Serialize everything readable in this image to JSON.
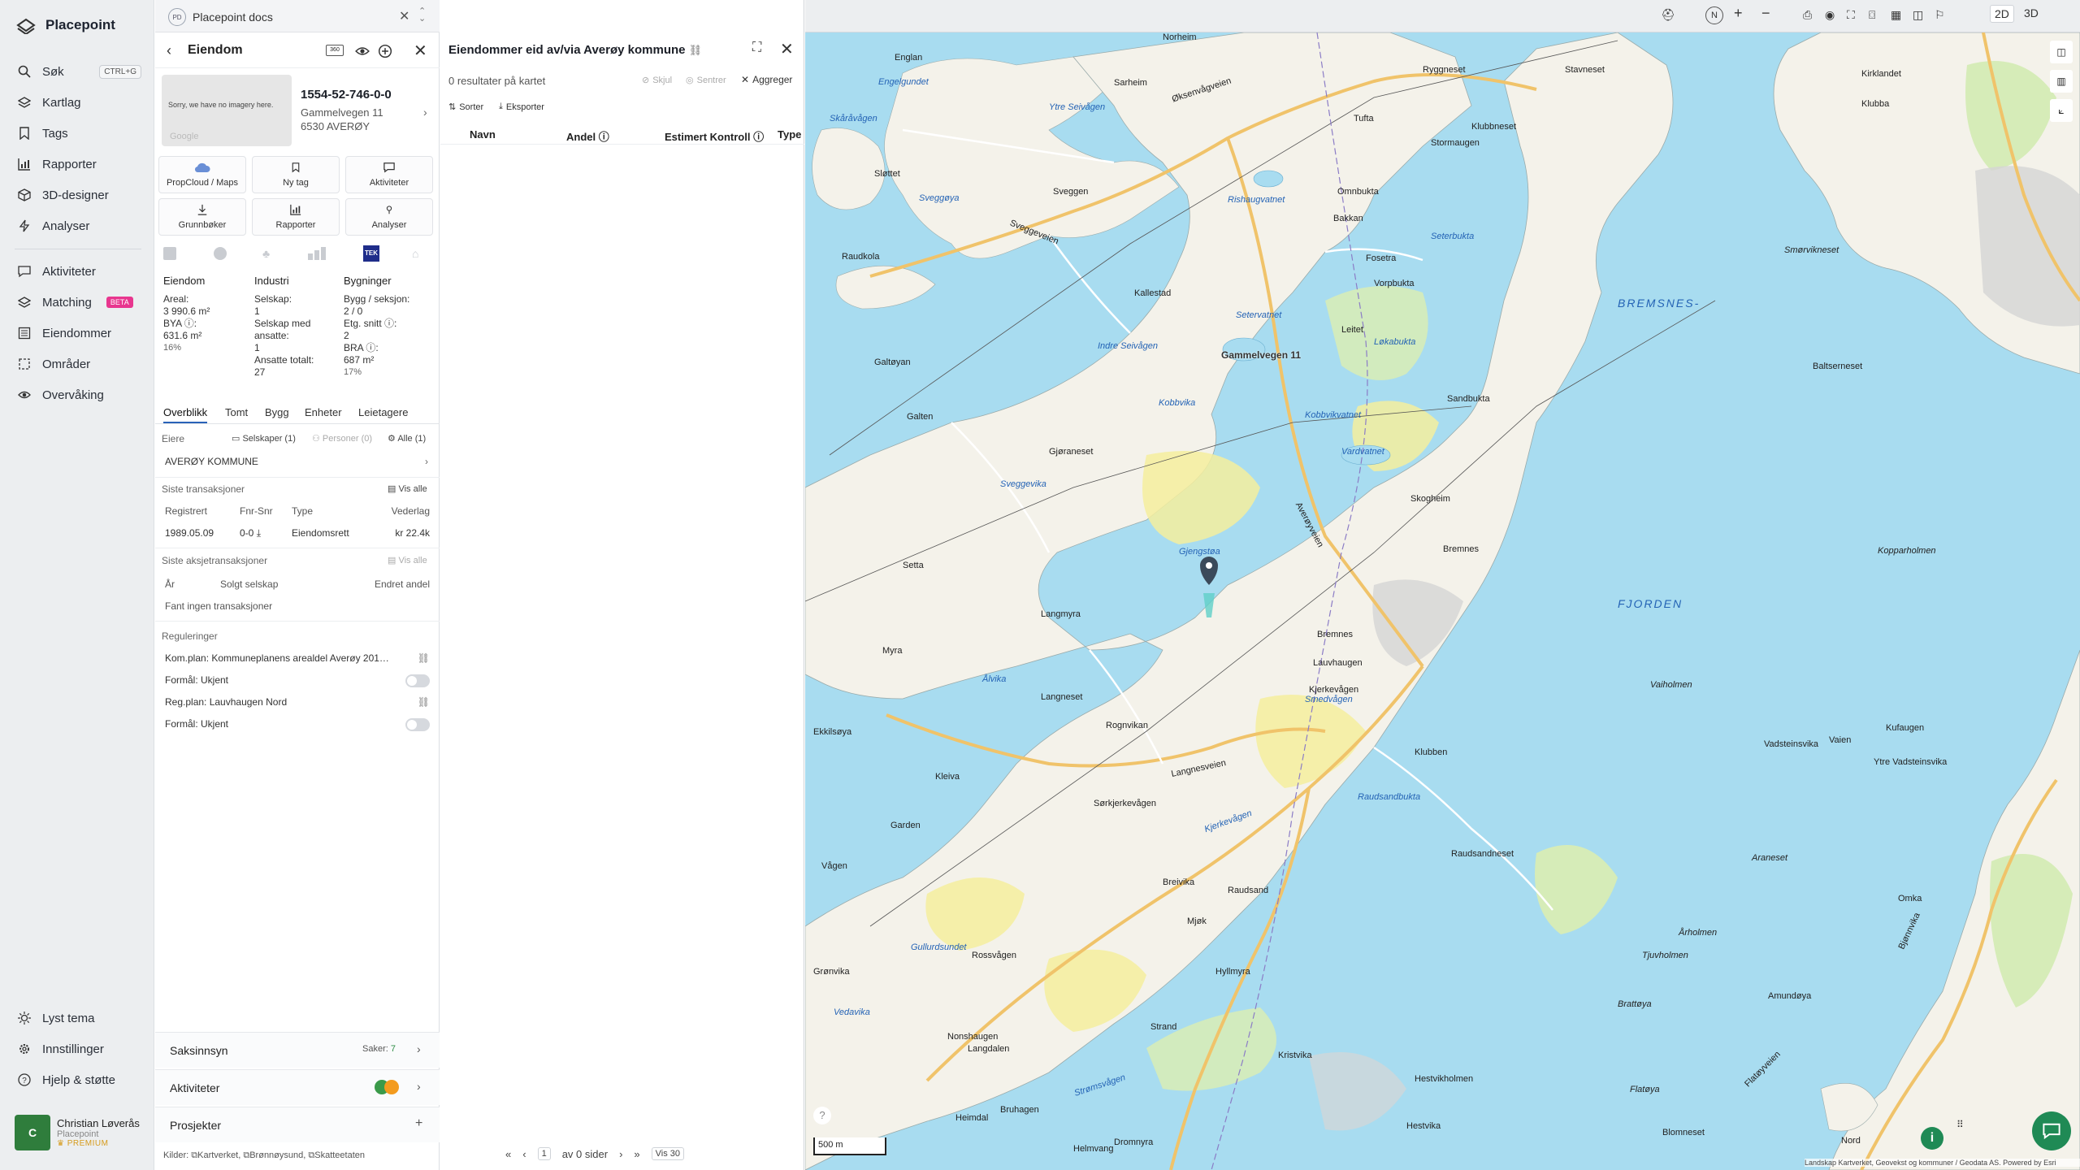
{
  "app": {
    "name": "Placepoint",
    "colors": {
      "accent": "#2962b8",
      "beta": "#e8368f",
      "nav_bg": "#eceef0"
    }
  },
  "nav": {
    "items": [
      {
        "label": "Søk",
        "shortcut": "CTRL+G",
        "icon": "search-icon"
      },
      {
        "label": "Kartlag",
        "icon": "layers-icon"
      },
      {
        "label": "Tags",
        "icon": "bookmark-icon"
      },
      {
        "label": "Rapporter",
        "icon": "chart-icon"
      },
      {
        "label": "3D-designer",
        "icon": "cube-icon"
      },
      {
        "label": "Analyser",
        "icon": "lightning-icon"
      },
      {
        "label": "Aktiviteter",
        "icon": "chat-icon"
      },
      {
        "label": "Matching",
        "badge": "BETA",
        "icon": "layers-icon"
      },
      {
        "label": "Eiendommer",
        "icon": "list-icon"
      },
      {
        "label": "Områder",
        "icon": "area-icon"
      },
      {
        "label": "Overvåking",
        "icon": "eye-icon"
      }
    ],
    "bottom": [
      {
        "label": "Lyst tema",
        "icon": "sun-icon"
      },
      {
        "label": "Innstillinger",
        "icon": "gear-icon"
      },
      {
        "label": "Hjelp & støtte",
        "icon": "help-icon"
      }
    ],
    "user": {
      "initial": "C",
      "name": "Christian Løverås",
      "org": "Placepoint",
      "plan": "PREMIUM"
    }
  },
  "tab": {
    "chip": "PD",
    "title": "Placepoint docs"
  },
  "property": {
    "header": "Eiendom",
    "no_imagery": "Sorry, we have no imagery here.",
    "google": "Google",
    "id": "1554-52-746-0-0",
    "street": "Gammelvegen 11",
    "postal": "6530 AVERØY",
    "actions": [
      "PropCloud / Maps",
      "Ny tag",
      "Aktiviteter",
      "Grunnbøker",
      "Rapporter",
      "Analyser"
    ],
    "tek_label": "TEK",
    "info": {
      "eiendom": {
        "title": "Eiendom",
        "areal_label": "Areal:",
        "areal": "3 990.6 m²",
        "bya_label": "BYA ⓘ:",
        "bya": "631.6 m²",
        "bya_pct": "16%"
      },
      "industri": {
        "title": "Industri",
        "selskap_label": "Selskap:",
        "selskap": "1",
        "med_ansatte_label": "Selskap med ansatte:",
        "med_ansatte": "1",
        "ansatte_label": "Ansatte totalt:",
        "ansatte": "27"
      },
      "bygninger": {
        "title": "Bygninger",
        "bygg_label": "Bygg / seksjon:",
        "bygg": "2 / 0",
        "etg_label": "Etg. snitt ⓘ:",
        "etg": "2",
        "bra_label": "BRA ⓘ:",
        "bra": "687 m²",
        "bra_pct": "17%"
      }
    },
    "tabs": [
      "Overblikk",
      "Tomt",
      "Bygg",
      "Enheter",
      "Leietagere"
    ],
    "eiere_label": "Eiere",
    "eiere_filters": [
      "Selskaper (1)",
      "Personer (0)",
      "Alle (1)"
    ],
    "owner": "AVERØY KOMMUNE",
    "transaksjoner": {
      "title": "Siste transaksjoner",
      "vis_alle": "Vis alle",
      "headers": [
        "Registrert",
        "Fnr-Snr",
        "Type",
        "Vederlag"
      ],
      "rows": [
        {
          "registrert": "1989.05.09",
          "fnr": "0-0",
          "type": "Eiendomsrett",
          "vederlag": "kr 22.4k"
        }
      ]
    },
    "aksjer": {
      "title": "Siste aksjetransaksjoner",
      "vis_alle": "Vis alle",
      "headers": [
        "År",
        "Solgt selskap",
        "Endret andel"
      ],
      "empty": "Fant ingen transaksjoner"
    },
    "reguleringer": {
      "title": "Reguleringer",
      "rows": [
        {
          "label": "Kom.plan: Kommuneplanens arealdel Averøy 201…",
          "kind": "link"
        },
        {
          "label": "Formål: Ukjent",
          "kind": "toggle"
        },
        {
          "label": "Reg.plan: Lauvhaugen Nord",
          "kind": "link"
        },
        {
          "label": "Formål: Ukjent",
          "kind": "toggle"
        }
      ]
    },
    "accordions": [
      {
        "label": "Saksinnsyn",
        "meta": "Saker:",
        "count": "7"
      },
      {
        "label": "Aktiviteter"
      },
      {
        "label": "Prosjekter"
      }
    ],
    "kilder": {
      "label": "Kilder:",
      "sources": [
        "Kartverket,",
        "Brønnøysund,",
        "Skatteetaten"
      ]
    }
  },
  "owned": {
    "title": "Eiendommer eid av/via Averøy kommune",
    "results": "0 resultater på kartet",
    "actions": [
      "Skjul",
      "Sentrer",
      "Aggreger"
    ],
    "toolbar": [
      "Sorter",
      "Eksporter"
    ],
    "columns": [
      "Navn",
      "Andel ⓘ",
      "Estimert Kontroll ⓘ",
      "Type"
    ],
    "pager": {
      "page": "1",
      "of_label": "av 0 sider",
      "per_page": "Vis 30"
    }
  },
  "map": {
    "mode_2d": "2D",
    "mode_3d": "3D",
    "marker_label": "Gammelvegen 11",
    "scale": "500 m",
    "attribution": "Landskap Kartverket, Geovekst og kommuner / Geodata AS. Powered by Esri",
    "places": [
      "Englan",
      "Engelgundet",
      "Skåråvågen",
      "Sløttet",
      "Sveggøya",
      "Raudkola",
      "Galtøyan",
      "Galten",
      "Gjøraneset",
      "Sveggevika",
      "Setta",
      "Myra",
      "Ålvika",
      "Ekkilsøya",
      "Kleiva",
      "Garden",
      "Vågen",
      "Rossvågen",
      "Gullurdsundet",
      "Grønvika",
      "Vedavika",
      "Norheim",
      "Sarheim",
      "Øksenvågveien",
      "Ytre Seivågen",
      "Sveggen",
      "Sveggeveien",
      "Rishaugvatnet",
      "Kallestad",
      "Setervatnet",
      "Indre Seivågen",
      "Kobbvika",
      "Kobbvikvatnet",
      "Vardvatnet",
      "Gjengstøa",
      "Averøyveien",
      "Langmyra",
      "Bremnes",
      "Lauvhaugen",
      "Kjerkevågen",
      "Rognvikan",
      "Langneset",
      "Langnesveien",
      "Sørkjerkevågen",
      "Kjerkevågen",
      "Breivika",
      "Mjøk",
      "Langdalen",
      "Nonshaugen",
      "Heimdal",
      "Bruhagen",
      "Strømsvågen",
      "Dromnyra",
      "Helmvang",
      "Stavneset",
      "Ryggneset",
      "Tufta",
      "Stormaugen",
      "Omnbukta",
      "Bakkan",
      "Seterbukta",
      "Fosetra",
      "Vorpbukta",
      "Leitet",
      "Løkabukta",
      "Sandbukta",
      "Skogheim",
      "Bremnes",
      "Smedvågen",
      "Klubben",
      "Raudsandbukta",
      "Raudsand",
      "Raudsandneset",
      "Kristvika",
      "Hestvikholmen",
      "Hestvika",
      "Strand",
      "Hyllmyra",
      "Klubbneset",
      "Kirklandet",
      "Klubba",
      "Smørvikneset",
      "Baltserneset",
      "Kopparholmen",
      "Vaiholmen",
      "Vadsteinsvika",
      "Vaien",
      "Kufaugen",
      "Ytre Vadsteinsvika",
      "Araneset",
      "Årholmen",
      "Tjuvholmen",
      "Amundøya",
      "Brattøya",
      "Flatøya",
      "Blomneset",
      "Flatøyveien",
      "Omka",
      "Bjønnvika",
      "Nord"
    ],
    "seas": [
      "BREMSNES-",
      "FJORDEN"
    ]
  }
}
